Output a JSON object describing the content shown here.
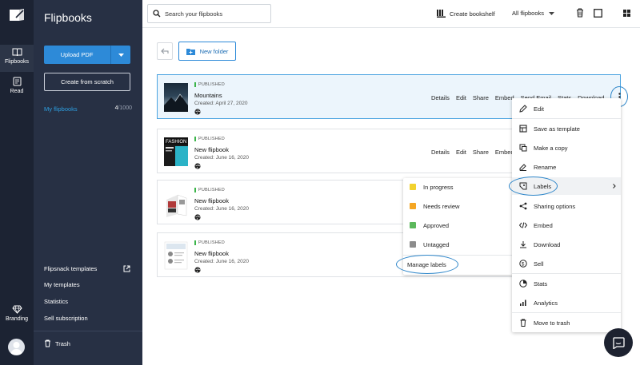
{
  "app": {
    "title": "Flipbooks"
  },
  "rail": {
    "items": [
      {
        "label": "Flipbooks",
        "icon": "book-open-icon"
      },
      {
        "label": "Read",
        "icon": "reader-icon"
      },
      {
        "label": "Branding",
        "icon": "diamond-icon"
      }
    ]
  },
  "sidebar": {
    "upload_label": "Upload PDF",
    "scratch_label": "Create from scratch",
    "my_flipbooks": {
      "label": "My flipbooks",
      "count": "4",
      "limit": "/1000"
    },
    "links": [
      "Flipsnack templates",
      "My templates",
      "Statistics",
      "Sell subscription"
    ],
    "trash_label": "Trash"
  },
  "topbar": {
    "search_placeholder": "Search your flipbooks",
    "create_bookshelf": "Create bookshelf",
    "filter_value": "All flipbooks"
  },
  "toolbar": {
    "new_folder": "New folder"
  },
  "flipbooks": [
    {
      "status": "PUBLISHED",
      "title": "Mountains",
      "created": "Created: April 27, 2020"
    },
    {
      "status": "PUBLISHED",
      "title": "New flipbook",
      "created": "Created: June 16, 2020"
    },
    {
      "status": "PUBLISHED",
      "title": "New flipbook",
      "created": "Created: June 16, 2020"
    },
    {
      "status": "PUBLISHED",
      "title": "New flipbook",
      "created": "Created: June 16, 2020"
    }
  ],
  "row_actions": [
    "Details",
    "Edit",
    "Share",
    "Embed",
    "Send Email",
    "Stats",
    "Download"
  ],
  "context_menu": [
    {
      "label": "Edit",
      "icon": "pencil-icon"
    },
    {
      "label": "Save as template",
      "icon": "template-icon"
    },
    {
      "label": "Make a copy",
      "icon": "copy-icon"
    },
    {
      "label": "Rename",
      "icon": "rename-icon"
    },
    {
      "label": "Labels",
      "icon": "label-icon"
    },
    {
      "label": "Sharing options",
      "icon": "share-icon"
    },
    {
      "label": "Embed",
      "icon": "code-icon"
    },
    {
      "label": "Download",
      "icon": "download-icon"
    },
    {
      "label": "Sell",
      "icon": "dollar-icon"
    },
    {
      "label": "Stats",
      "icon": "pie-chart-icon"
    },
    {
      "label": "Analytics",
      "icon": "bar-chart-icon"
    },
    {
      "label": "Move to trash",
      "icon": "trash-icon"
    }
  ],
  "labels_submenu": {
    "items": [
      {
        "label": "In progress",
        "color": "#f2d22e"
      },
      {
        "label": "Needs review",
        "color": "#f5a623"
      },
      {
        "label": "Approved",
        "color": "#5cb85c"
      },
      {
        "label": "Untagged",
        "color": "#8c8c8c"
      }
    ],
    "manage_label": "Manage labels"
  },
  "colors": {
    "accent": "#2d8ad8",
    "sidebar": "#273044",
    "rail": "#1c2333",
    "published": "#3bb54a"
  }
}
